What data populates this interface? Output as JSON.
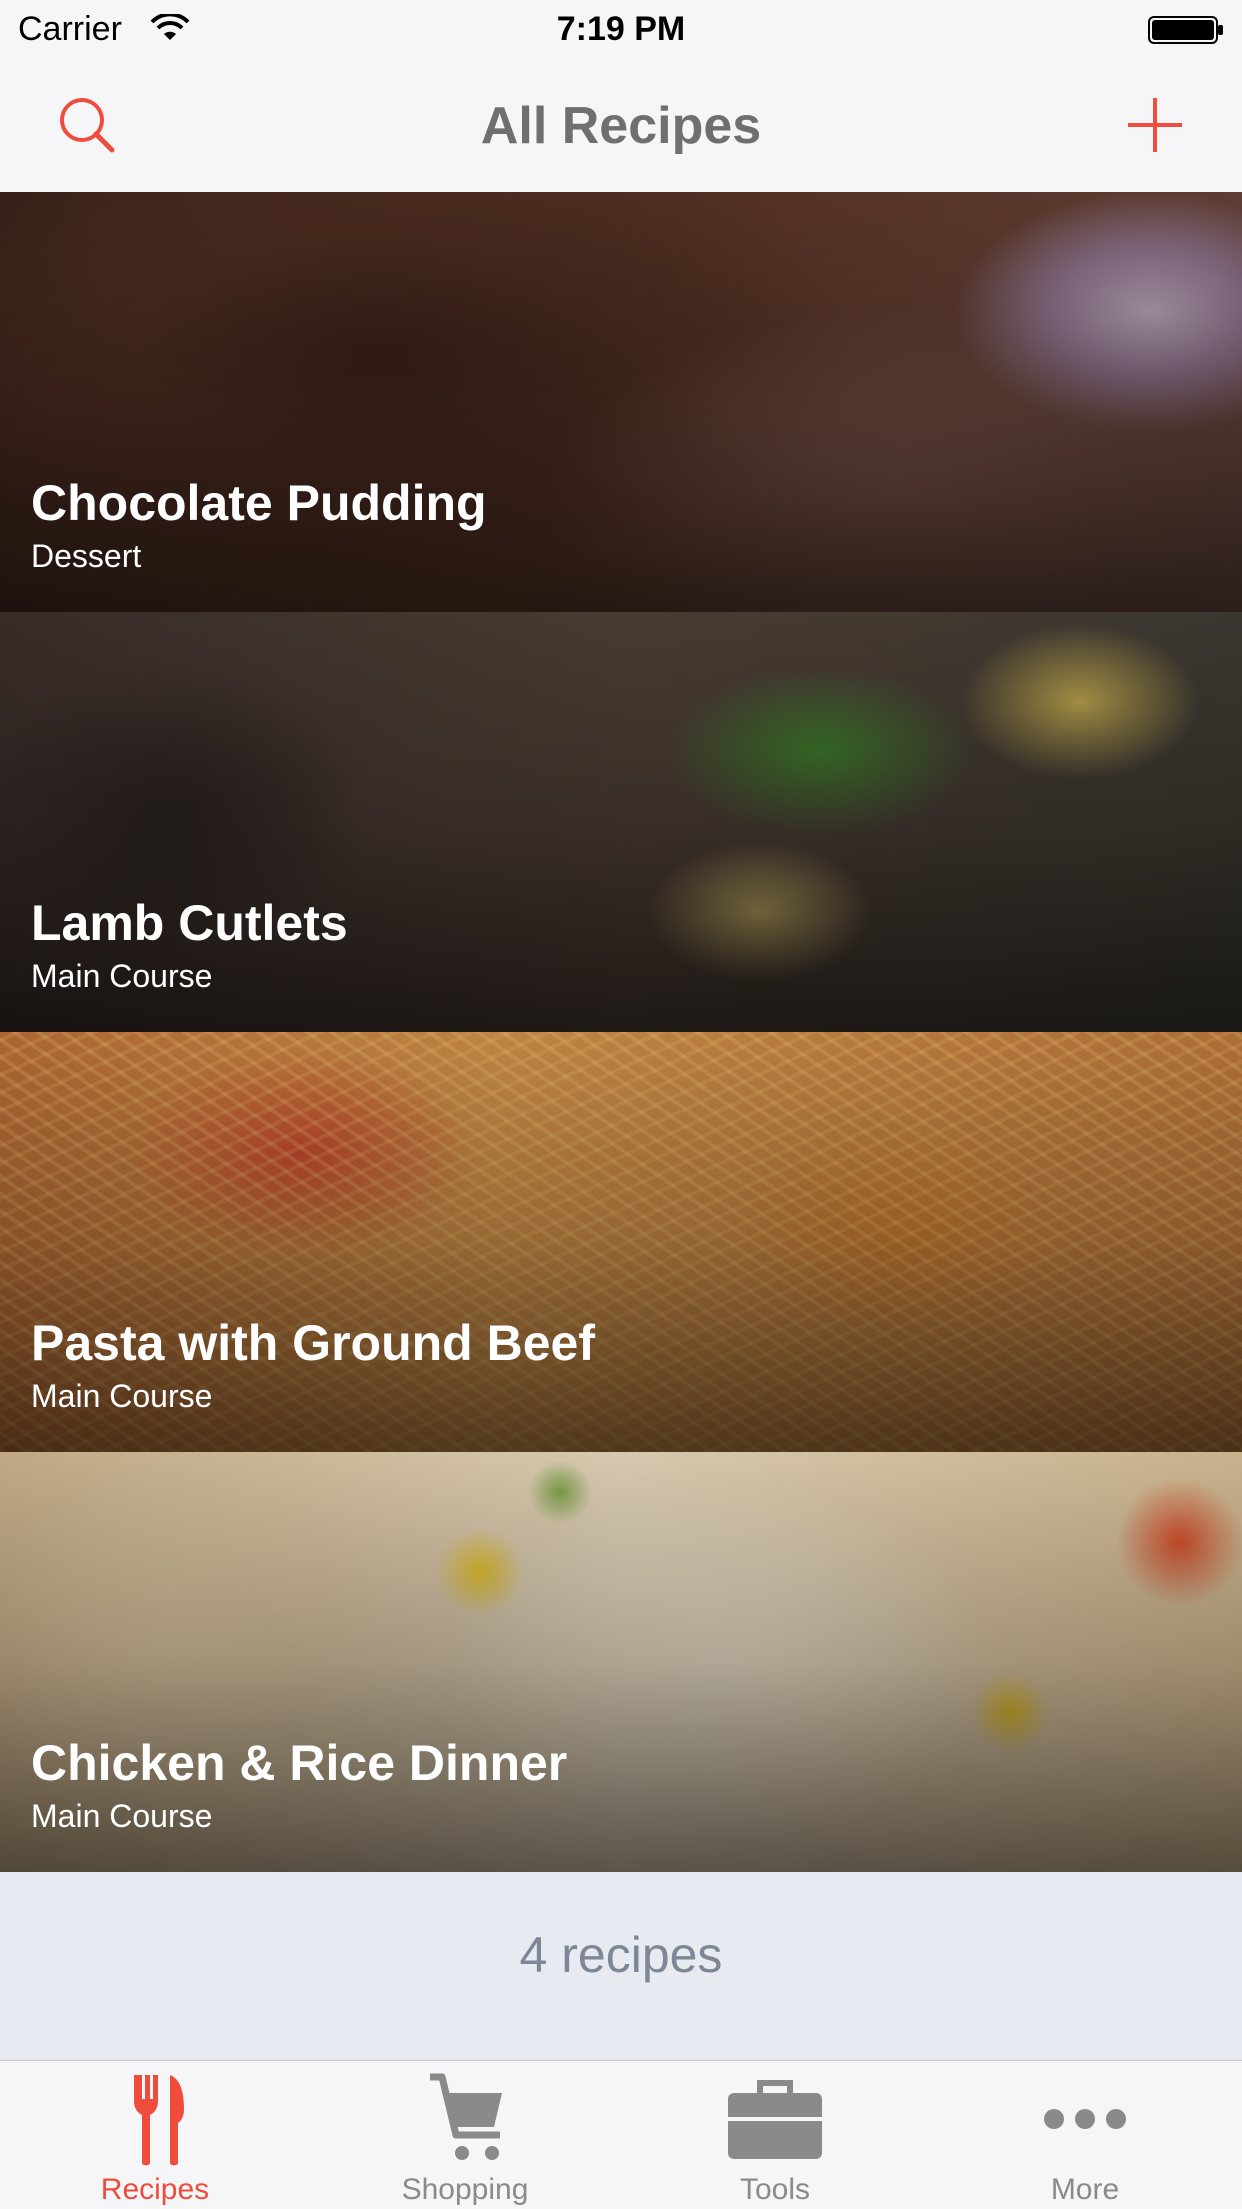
{
  "status_bar": {
    "carrier": "Carrier",
    "time": "7:19 PM"
  },
  "nav": {
    "title": "All Recipes",
    "left_icon": "search-icon",
    "right_icon": "plus-icon"
  },
  "recipes": [
    {
      "name": "Chocolate Pudding",
      "category": "Dessert"
    },
    {
      "name": "Lamb Cutlets",
      "category": "Main Course"
    },
    {
      "name": "Pasta with Ground Beef",
      "category": "Main Course"
    },
    {
      "name": "Chicken & Rice Dinner",
      "category": "Main Course"
    }
  ],
  "footer": {
    "count_text": "4 recipes"
  },
  "tabs": [
    {
      "label": "Recipes",
      "icon": "fork-knife-icon",
      "active": true
    },
    {
      "label": "Shopping",
      "icon": "cart-icon",
      "active": false
    },
    {
      "label": "Tools",
      "icon": "toolbox-icon",
      "active": false
    },
    {
      "label": "More",
      "icon": "more-dots-icon",
      "active": false
    }
  ],
  "colors": {
    "accent": "#f04c3e",
    "inactive": "#8a8a8a",
    "title": "#6f6f6f"
  }
}
